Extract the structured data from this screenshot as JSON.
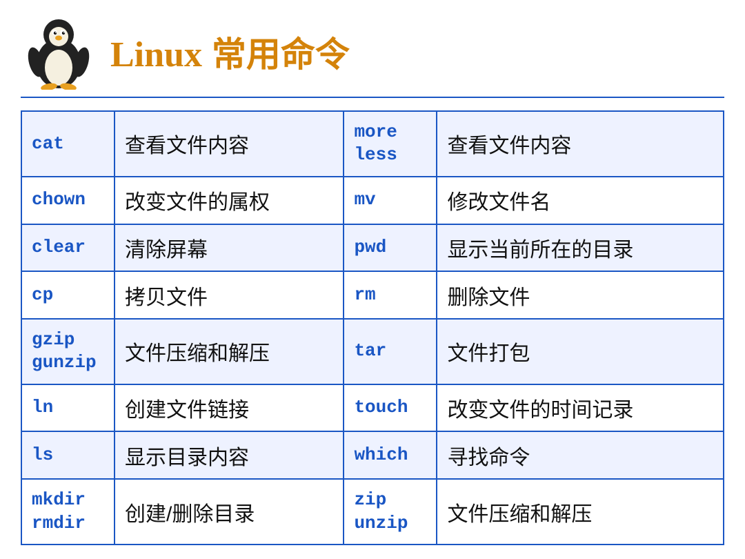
{
  "header": {
    "title_en": "Linux",
    "title_zh": " 常用命令"
  },
  "table": {
    "rows": [
      {
        "cmd1": "cat",
        "desc1": "查看文件内容",
        "cmd2": "more\nless",
        "desc2": "查看文件内容"
      },
      {
        "cmd1": "chown",
        "desc1": "改变文件的属权",
        "cmd2": "mv",
        "desc2": "修改文件名"
      },
      {
        "cmd1": "clear",
        "desc1": "清除屏幕",
        "cmd2": "pwd",
        "desc2": "显示当前所在的目录"
      },
      {
        "cmd1": "cp",
        "desc1": "拷贝文件",
        "cmd2": "rm",
        "desc2": "删除文件"
      },
      {
        "cmd1": "gzip\ngunzip",
        "desc1": "文件压缩和解压",
        "cmd2": "tar",
        "desc2": "文件打包"
      },
      {
        "cmd1": "ln",
        "desc1": "创建文件链接",
        "cmd2": "touch",
        "desc2": "改变文件的时间记录"
      },
      {
        "cmd1": "ls",
        "desc1": "显示目录内容",
        "cmd2": "which",
        "desc2": "寻找命令"
      },
      {
        "cmd1": "mkdir\nrmdir",
        "desc1": "创建/删除目录",
        "cmd2": "zip\nunzip",
        "desc2": "文件压缩和解压"
      }
    ]
  }
}
